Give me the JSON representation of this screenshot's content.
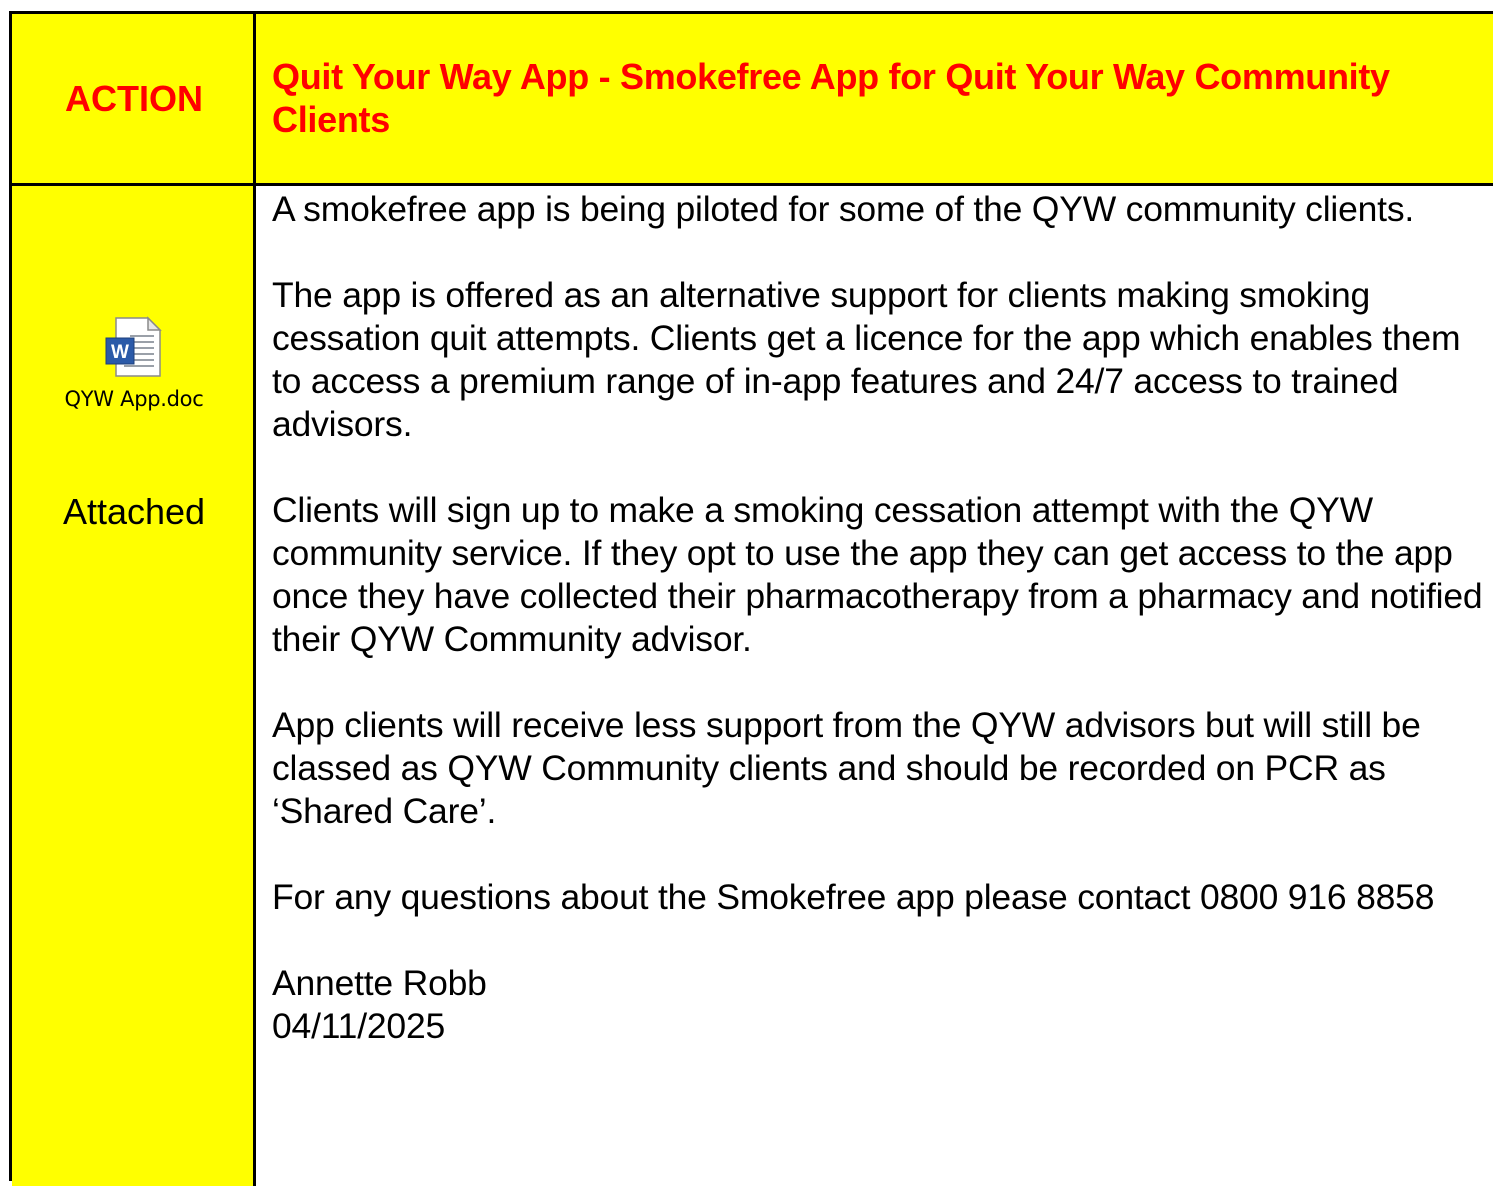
{
  "header": {
    "action_label": "ACTION",
    "title": "Quit Your Way App - Smokefree App for Quit Your Way Community Clients"
  },
  "attachment": {
    "icon": "word-document-icon",
    "filename": "QYW App.doc",
    "status": "Attached"
  },
  "content": {
    "paragraphs": [
      "A smokefree app is being piloted for some of the QYW community clients.",
      "The app is offered as an alternative support for clients making smoking cessation quit attempts. Clients get a licence for the app which enables them to access a premium range of in-app features and 24/7 access to trained advisors.",
      "Clients will sign up to make a smoking cessation attempt with the QYW community service. If they opt to use the app they can get access to the app once they have collected their pharmacotherapy from a pharmacy and notified their QYW Community advisor.",
      "App clients will receive less support from the QYW advisors but will still be classed as QYW Community clients and should be recorded on PCR as ‘Shared Care’.",
      "For any questions about the Smokefree app please contact 0800 916 8858"
    ],
    "author": "Annette Robb",
    "date": "04/11/2025"
  },
  "colors": {
    "highlight": "#ffff00",
    "heading": "#ff0000",
    "border": "#000000"
  }
}
